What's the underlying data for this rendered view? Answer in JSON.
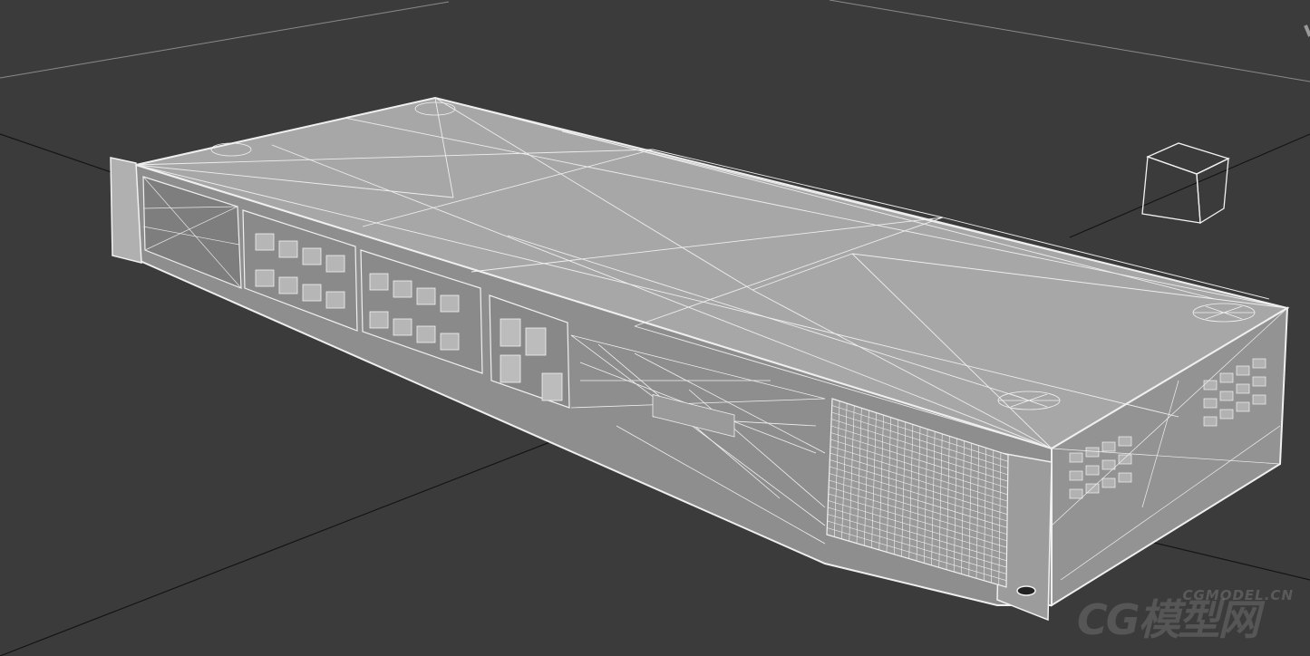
{
  "viewport": {
    "background_color": "#3b3b3b",
    "grid_color": "#151515",
    "grid_light_color": "#8a8a8a",
    "mesh_fill": "#a6a6a6",
    "mesh_fill_dark": "#8c8c8c",
    "mesh_shadow": "#6e6e6e",
    "wire_color": "#efefef",
    "helper_color": "#f2f2f2"
  },
  "scene": {
    "object": "rack-mount-network-switch",
    "display_mode": "wireframe-shaded",
    "helper": "box-gizmo"
  },
  "watermark": {
    "main": "CG模型网",
    "sub": "CGMODEL.CN"
  }
}
